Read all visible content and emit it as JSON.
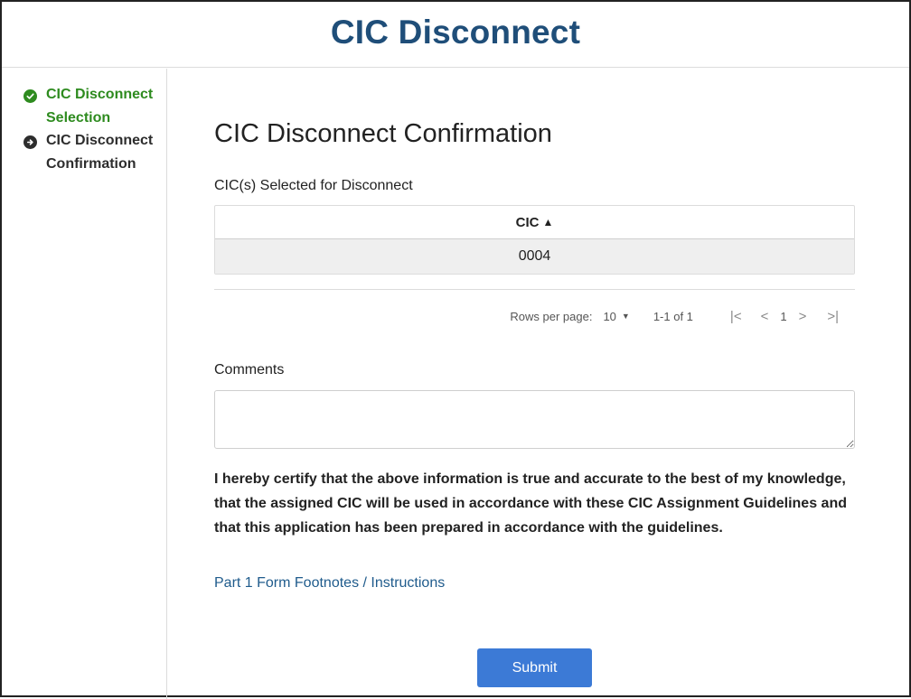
{
  "header": {
    "title": "CIC Disconnect"
  },
  "sidebar": {
    "steps": [
      {
        "label": "CIC Disconnect Selection",
        "status": "done",
        "icon": "check-circle-icon",
        "color": "#2e8b1f"
      },
      {
        "label": "CIC Disconnect Confirmation",
        "status": "current",
        "icon": "arrow-right-circle-icon",
        "color": "#2d2d2d"
      }
    ]
  },
  "main": {
    "title": "CIC Disconnect Confirmation",
    "table_label": "CIC(s) Selected for Disconnect",
    "table": {
      "columns": [
        {
          "label": "CIC",
          "sort": "ascending",
          "sort_icon": "▲"
        }
      ],
      "rows": [
        [
          "0004"
        ]
      ]
    },
    "pager": {
      "rows_per_page_label": "Rows per page:",
      "rows_per_page": "10",
      "range": "1-1 of 1",
      "page": "1",
      "first_icon": "|<",
      "prev_icon": "<",
      "next_icon": ">",
      "last_icon": ">|"
    },
    "comments": {
      "label": "Comments",
      "value": "",
      "placeholder": ""
    },
    "certification": "I hereby certify that the above information is true and accurate to the best of my knowledge, that the assigned CIC will be used in accordance with these CIC Assignment Guidelines and that this application has been prepared in accordance with the guidelines.",
    "footnote_link": "Part 1 Form Footnotes / Instructions",
    "submit_label": "Submit"
  },
  "colors": {
    "title": "#1f4e79",
    "accent": "#3c7ad6",
    "success": "#2e8b1f",
    "link": "#1f5b8c"
  }
}
